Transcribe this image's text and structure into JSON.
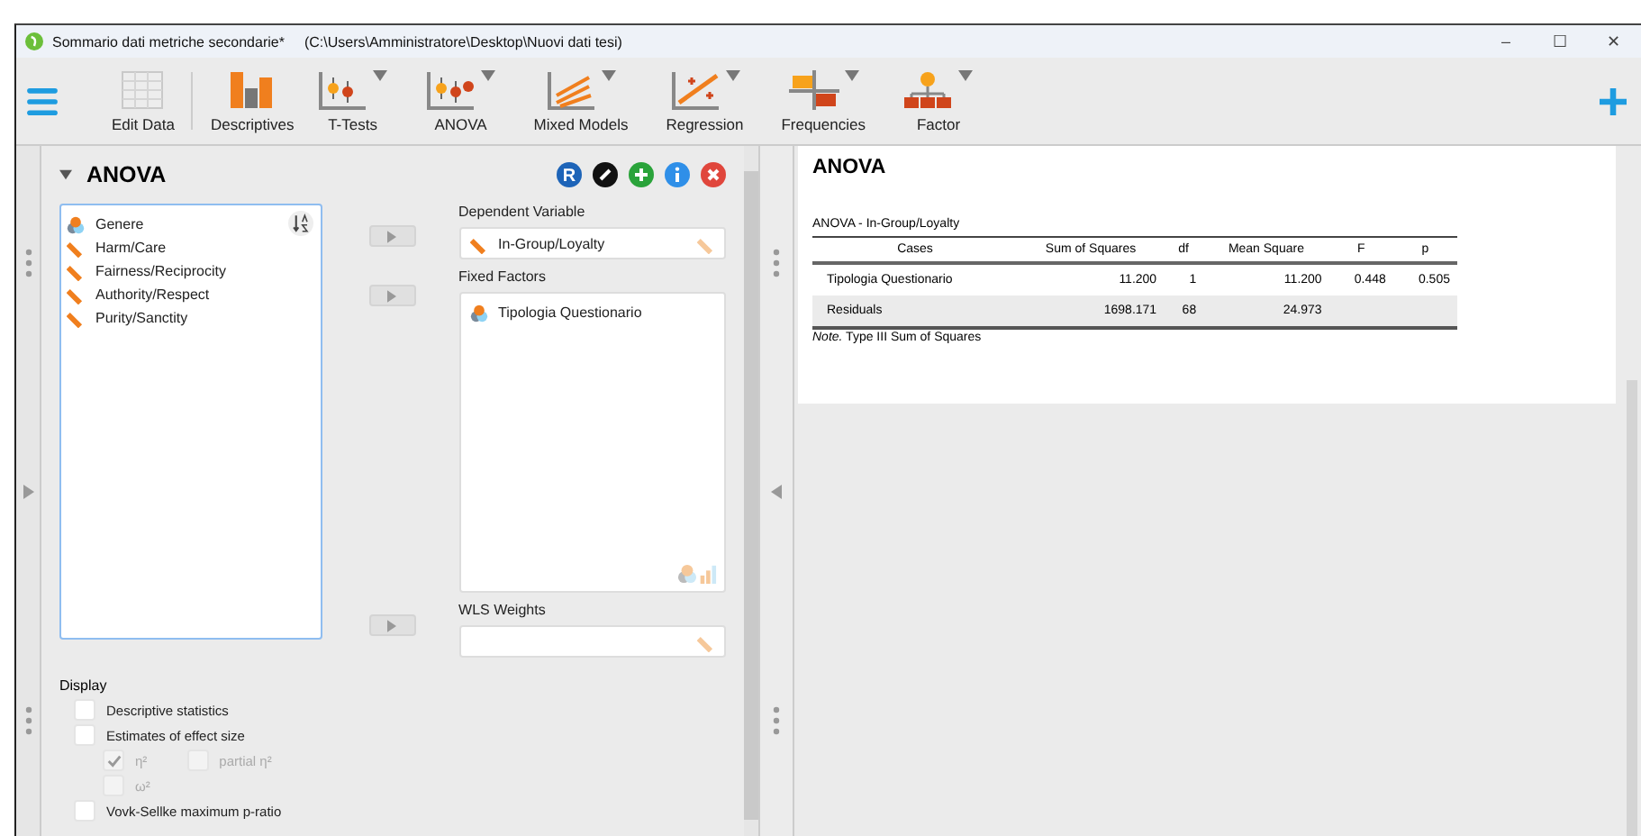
{
  "window": {
    "title": "Sommario dati metriche secondarie*",
    "path": "(C:\\Users\\Amministratore\\Desktop\\Nuovi dati tesi)",
    "controls": [
      "–",
      "☐",
      "✕"
    ]
  },
  "toolbar": [
    {
      "label": "Edit Data",
      "kind": "data",
      "disabled": true,
      "menu": false
    },
    {
      "label": "Descriptives",
      "kind": "bars",
      "disabled": false,
      "menu": false
    },
    {
      "label": "T-Tests",
      "kind": "ttest",
      "disabled": false,
      "menu": true
    },
    {
      "label": "ANOVA",
      "kind": "anova",
      "disabled": false,
      "menu": true
    },
    {
      "label": "Mixed Models",
      "kind": "mixed",
      "disabled": false,
      "menu": true
    },
    {
      "label": "Regression",
      "kind": "regression",
      "disabled": false,
      "menu": true
    },
    {
      "label": "Frequencies",
      "kind": "freq",
      "disabled": false,
      "menu": true
    },
    {
      "label": "Factor",
      "kind": "factor",
      "disabled": false,
      "menu": true
    }
  ],
  "analysis": {
    "title": "ANOVA",
    "expanded": true,
    "syntax_button": "R",
    "variables": [
      {
        "name": "Genere",
        "kind": "nominal"
      },
      {
        "name": "Harm/Care",
        "kind": "scale"
      },
      {
        "name": "Fairness/Reciprocity",
        "kind": "scale"
      },
      {
        "name": "Authority/Respect",
        "kind": "scale"
      },
      {
        "name": "Purity/Sanctity",
        "kind": "scale"
      }
    ],
    "dependent_variable": {
      "label": "Dependent Variable",
      "items": [
        {
          "name": "In-Group/Loyalty",
          "kind": "scale"
        }
      ]
    },
    "fixed_factors": {
      "label": "Fixed Factors",
      "items": [
        {
          "name": "Tipologia Questionario",
          "kind": "nominal"
        }
      ]
    },
    "wls_weights": {
      "label": "WLS Weights"
    },
    "display": {
      "label": "Display",
      "options": [
        {
          "label": "Descriptive statistics",
          "checked": false,
          "disabled": false
        },
        {
          "label": "Estimates of effect size",
          "checked": false,
          "disabled": false,
          "children": [
            {
              "label": "η²",
              "checked": true,
              "disabled": true,
              "beside": {
                "label": "partial η²",
                "checked": false,
                "disabled": true
              }
            },
            {
              "label": "ω²",
              "checked": false,
              "disabled": true
            }
          ]
        },
        {
          "label": "Vovk-Sellke maximum p-ratio",
          "checked": false,
          "disabled": false
        }
      ]
    }
  },
  "results": {
    "heading": "ANOVA",
    "table": {
      "title": "ANOVA - In-Group/Loyalty",
      "columns": [
        "Cases",
        "Sum of Squares",
        "df",
        "Mean Square",
        "F",
        "p"
      ],
      "rows": [
        [
          "Tipologia Questionario",
          "11.200",
          "1",
          "11.200",
          "0.448",
          "0.505"
        ],
        [
          "Residuals",
          "1698.171",
          "68",
          "24.973",
          "",
          ""
        ]
      ],
      "note": "*Note.* Type III Sum of Squares"
    }
  }
}
